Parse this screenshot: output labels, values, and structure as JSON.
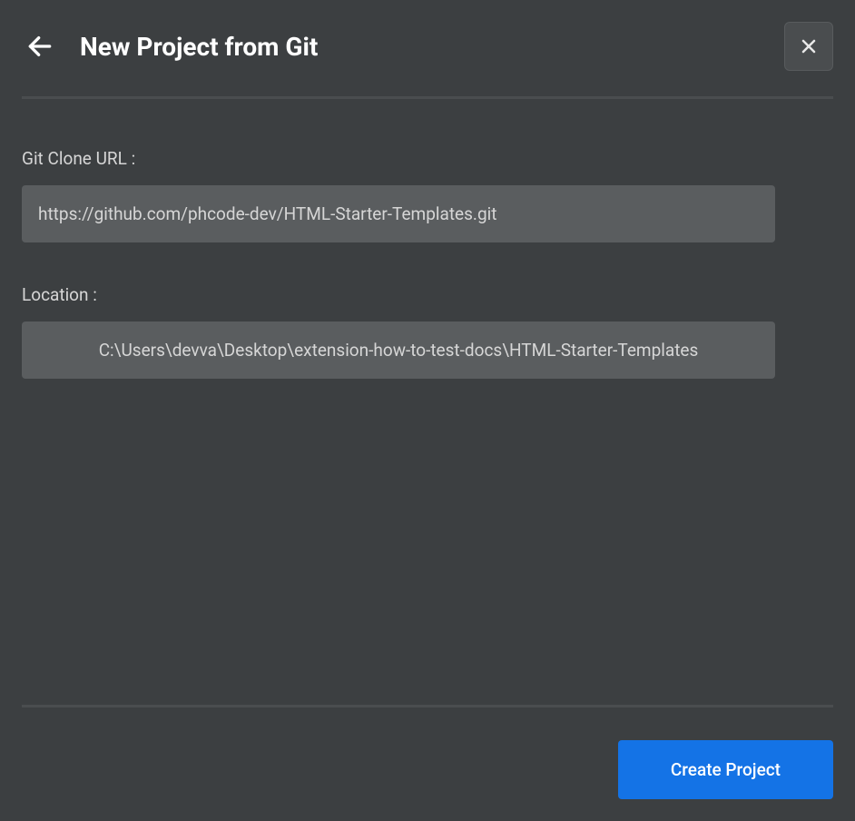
{
  "header": {
    "title": "New Project from Git"
  },
  "form": {
    "gitCloneUrl": {
      "label": "Git Clone URL :",
      "value": "https://github.com/phcode-dev/HTML-Starter-Templates.git"
    },
    "location": {
      "label": "Location :",
      "value": "C:\\Users\\devva\\Desktop\\extension-how-to-test-docs\\HTML-Starter-Templates"
    }
  },
  "footer": {
    "createButton": "Create Project"
  }
}
